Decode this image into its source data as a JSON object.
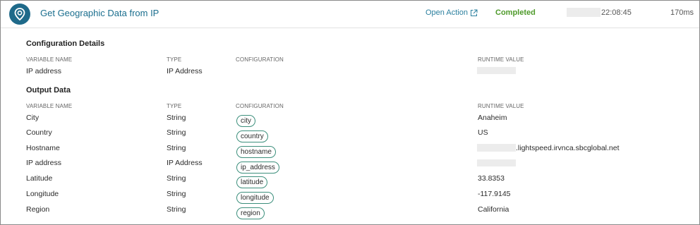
{
  "header": {
    "action_title": "Get Geographic Data from IP",
    "open_action_label": "Open Action",
    "status": "Completed",
    "time": "22:08:45",
    "duration": "170ms",
    "status_color": "#4e9a2a",
    "accent_color": "#1a6e8e",
    "icon": "map-pin-icon"
  },
  "config": {
    "title": "Configuration Details",
    "columns": {
      "variable": "VARIABLE NAME",
      "type": "TYPE",
      "configuration": "CONFIGURATION",
      "runtime": "RUNTIME VALUE"
    },
    "rows": [
      {
        "variable": "IP address",
        "type": "IP Address",
        "configuration": "",
        "runtime": ""
      }
    ]
  },
  "output": {
    "title": "Output Data",
    "columns": {
      "variable": "VARIABLE NAME",
      "type": "TYPE",
      "configuration": "CONFIGURATION",
      "runtime": "RUNTIME VALUE"
    },
    "rows": [
      {
        "variable": "City",
        "type": "String",
        "configuration": "city",
        "runtime": "Anaheim"
      },
      {
        "variable": "Country",
        "type": "String",
        "configuration": "country",
        "runtime": "US"
      },
      {
        "variable": "Hostname",
        "type": "String",
        "configuration": "hostname",
        "runtime": ".lightspeed.irvnca.sbcglobal.net"
      },
      {
        "variable": "IP address",
        "type": "IP Address",
        "configuration": "ip_address",
        "runtime": ""
      },
      {
        "variable": "Latitude",
        "type": "String",
        "configuration": "latitude",
        "runtime": "33.8353"
      },
      {
        "variable": "Longitude",
        "type": "String",
        "configuration": "longitude",
        "runtime": "-117.9145"
      },
      {
        "variable": "Region",
        "type": "String",
        "configuration": "region",
        "runtime": "California"
      }
    ]
  }
}
